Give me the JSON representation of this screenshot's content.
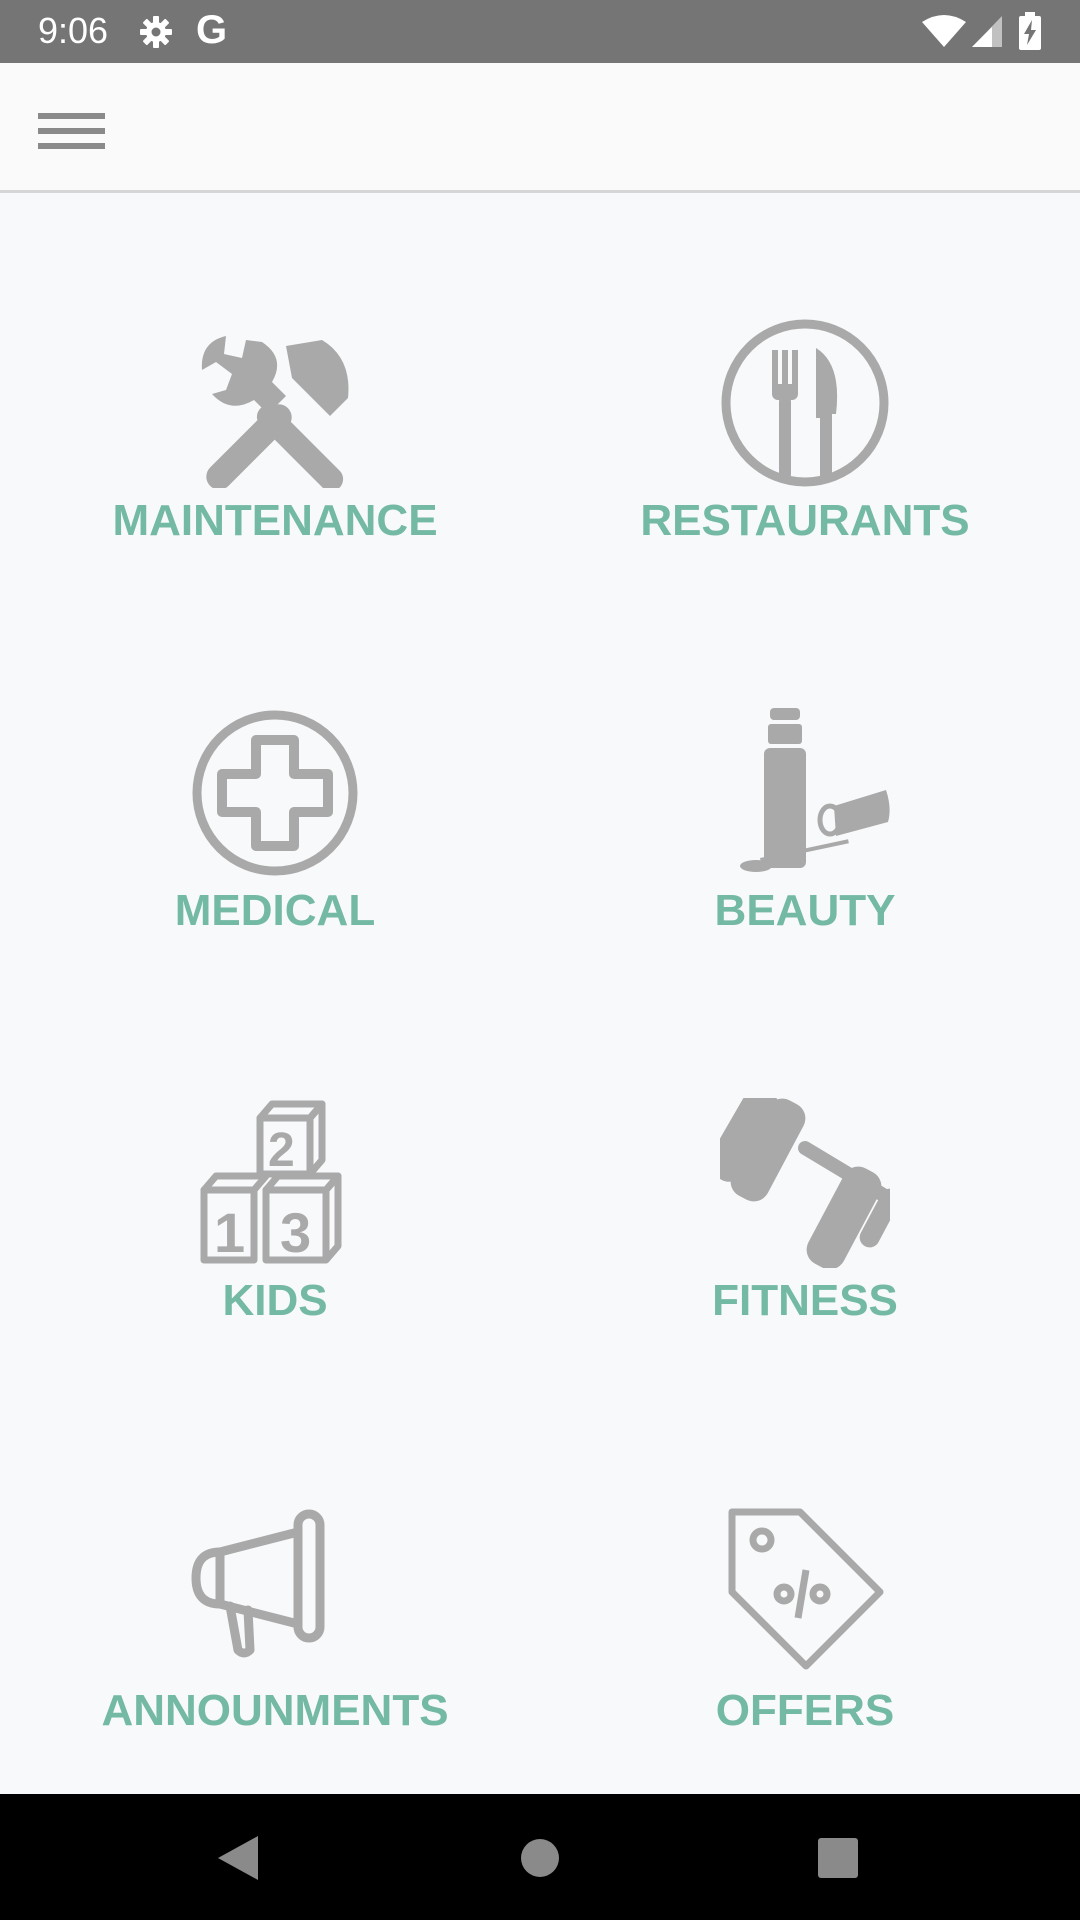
{
  "status_bar": {
    "time": "9:06",
    "google_glyph": "G",
    "icons": [
      "gear-icon",
      "wifi-icon",
      "signal-icon",
      "battery-charging-icon"
    ]
  },
  "app_bar": {
    "menu_icon": "hamburger-menu-icon"
  },
  "colors": {
    "label_green": "#73b9a4",
    "icon_gray": "#a9a9a9",
    "status_bar": "#757575",
    "background": "#f8f9fa",
    "nav_bar": "#000000"
  },
  "categories": [
    {
      "label": "MAINTENANCE",
      "icon": "tools-icon"
    },
    {
      "label": "RESTAURANTS",
      "icon": "fork-knife-plate-icon"
    },
    {
      "label": "MEDICAL",
      "icon": "medical-cross-icon"
    },
    {
      "label": "BEAUTY",
      "icon": "lip-gloss-icon"
    },
    {
      "label": "KIDS",
      "icon": "toy-blocks-icon"
    },
    {
      "label": "FITNESS",
      "icon": "dumbbell-icon"
    },
    {
      "label": "ANNOUNMENTS",
      "icon": "megaphone-icon"
    },
    {
      "label": "OFFERS",
      "icon": "discount-tag-icon"
    }
  ],
  "nav_bar": {
    "icons": [
      "back-icon",
      "home-icon",
      "recents-icon"
    ]
  }
}
